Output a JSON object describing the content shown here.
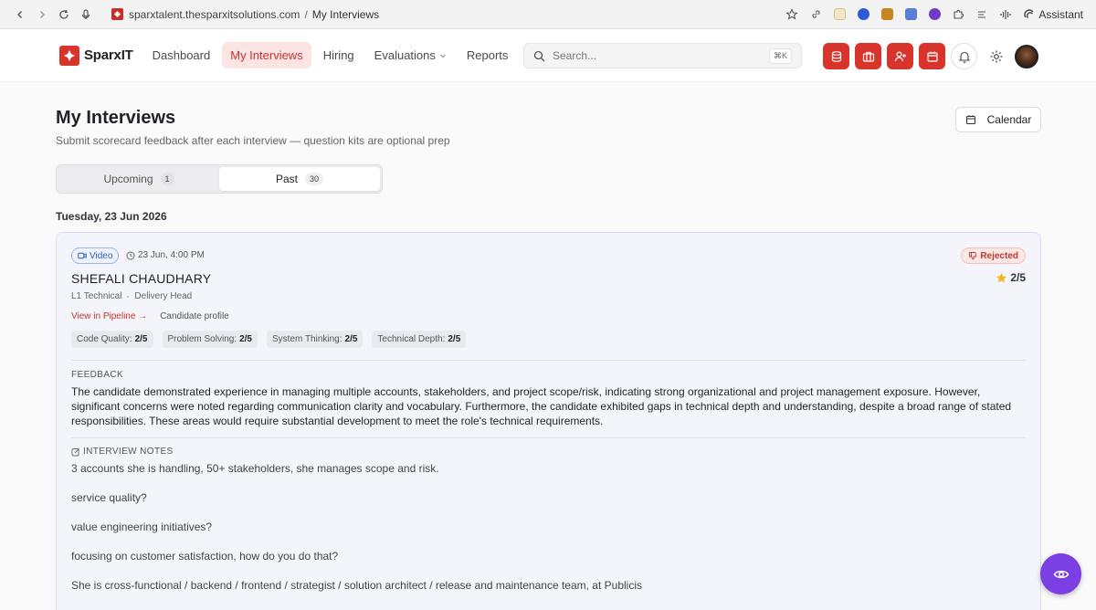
{
  "browser": {
    "url_host": "sparxtalent.thesparxitsolutions.com",
    "url_sep": "/",
    "page_title": "My Interviews",
    "assistant_label": "Assistant"
  },
  "header": {
    "logo_text": "SparxIT",
    "nav": [
      {
        "label": "Dashboard",
        "active": false
      },
      {
        "label": "My Interviews",
        "active": true
      },
      {
        "label": "Hiring",
        "active": false
      },
      {
        "label": "Evaluations",
        "active": false,
        "dropdown": true
      },
      {
        "label": "Reports",
        "active": false
      }
    ],
    "search_placeholder": "Search...",
    "search_shortcut": "⌘K",
    "accent": "#d8342b"
  },
  "page": {
    "title": "My Interviews",
    "subtitle": "Submit scorecard feedback after each interview — question kits are optional prep",
    "calendar_label": "Calendar",
    "tabs": [
      {
        "label": "Upcoming",
        "count": "1",
        "active": false
      },
      {
        "label": "Past",
        "count": "30",
        "active": true
      }
    ],
    "date_heading": "Tuesday, 23 Jun 2026"
  },
  "card": {
    "type": "Video",
    "time": "23 Jun, 4:00 PM",
    "status": "Rejected",
    "candidate": "SHEFALI CHAUDHARY",
    "rating": "2/5",
    "round": "L1 Technical",
    "role": "Delivery Head",
    "link_pipeline": "View in Pipeline →",
    "link_profile": "Candidate profile",
    "scores": [
      {
        "label": "Code Quality:",
        "value": "2/5"
      },
      {
        "label": "Problem Solving:",
        "value": "2/5"
      },
      {
        "label": "System Thinking:",
        "value": "2/5"
      },
      {
        "label": "Technical Depth:",
        "value": "2/5"
      }
    ],
    "feedback_label": "FEEDBACK",
    "feedback": "The candidate demonstrated experience in managing multiple accounts, stakeholders, and project scope/risk, indicating strong organizational and project management exposure. However, significant concerns were noted regarding communication clarity and vocabulary. Furthermore, the candidate exhibited gaps in technical depth and understanding, despite a broad range of stated responsibilities. These areas would require substantial development to meet the role's technical requirements.",
    "notes_label": "INTERVIEW NOTES",
    "notes": [
      "3 accounts she is handling, 50+ stakeholders, she manages scope and risk.",
      "service quality?",
      "value engineering initiatives?",
      "focusing on customer satisfaction, how do you do that?",
      "She is cross-functional / backend / frontend / strategist / solution architect / release and maintenance team, at Publicis"
    ]
  },
  "colors": {
    "fab": "#7b3fe4",
    "rejected": "#b53a30",
    "video": "#2f5fb8"
  }
}
